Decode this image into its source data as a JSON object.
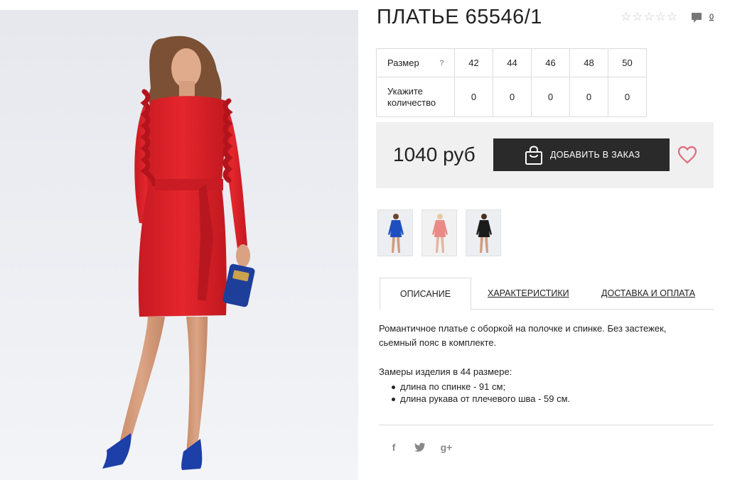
{
  "product": {
    "title": "ПЛАТЬЕ 65546/1",
    "rating_stars": 5,
    "rating_value": 0,
    "comments_count": "0",
    "price": "1040 руб",
    "add_to_order_label": "ДОБАВИТЬ В ЗАКАЗ"
  },
  "sizes_table": {
    "size_label": "Размер",
    "help_icon": "?",
    "qty_label_line1": "Укажите",
    "qty_label_line2": "количество",
    "sizes": [
      "42",
      "44",
      "46",
      "48",
      "50"
    ],
    "quantities": [
      "0",
      "0",
      "0",
      "0",
      "0"
    ]
  },
  "variants": [
    {
      "color": "#1f4fbf",
      "name": "blue"
    },
    {
      "color": "#e98a86",
      "name": "pink"
    },
    {
      "color": "#1b1b1b",
      "name": "black"
    }
  ],
  "tabs": [
    {
      "label": "ОПИСАНИЕ",
      "active": true
    },
    {
      "label": "ХАРАКТЕРИСТИКИ",
      "active": false
    },
    {
      "label": "ДОСТАВКА И ОПЛАТА",
      "active": false
    }
  ],
  "description": {
    "text_line1": "Романтичное платье с оборкой на полочке и спинке. Без застежек,",
    "text_line2": "сьемный пояс в комплекте.",
    "measures_title": "Замеры изделия в 44 размере:",
    "measures": [
      "длина по спинке - 91 см;",
      "длина рукава от плечевого шва - 59 см."
    ]
  },
  "social": {
    "facebook": "f",
    "twitter": "twitter-icon",
    "googleplus": "g+"
  },
  "colors": {
    "dress_main": "#e0242b",
    "button_bg": "#2a2a2a",
    "heart": "#e06a7a",
    "panel_bg": "#f0f0f0"
  }
}
